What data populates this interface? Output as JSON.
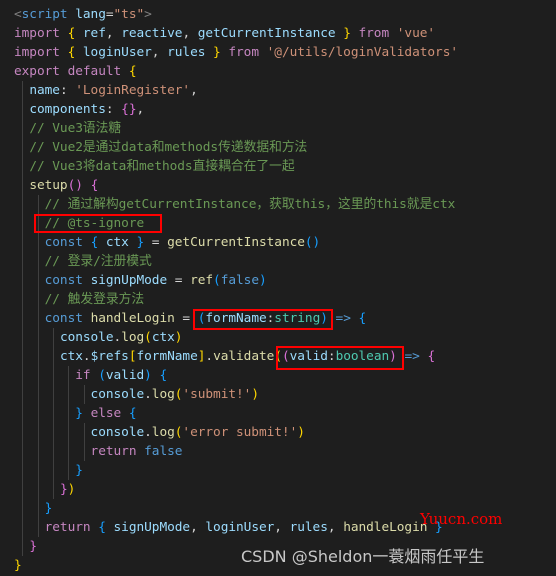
{
  "editor": {
    "language": "typescript",
    "lines": [
      [
        [
          "tag",
          "<"
        ],
        [
          "tagname",
          "script"
        ],
        [
          "p",
          " "
        ],
        [
          "var",
          "lang"
        ],
        [
          "p",
          "="
        ],
        [
          "str",
          "\"ts\""
        ],
        [
          "tag",
          ">"
        ]
      ],
      [
        [
          "kw",
          "import"
        ],
        [
          "p",
          " "
        ],
        [
          "b1",
          "{"
        ],
        [
          "p",
          " "
        ],
        [
          "var",
          "ref"
        ],
        [
          "p",
          ", "
        ],
        [
          "var",
          "reactive"
        ],
        [
          "p",
          ", "
        ],
        [
          "var",
          "getCurrentInstance"
        ],
        [
          "p",
          " "
        ],
        [
          "b1",
          "}"
        ],
        [
          "p",
          " "
        ],
        [
          "kw",
          "from"
        ],
        [
          "p",
          " "
        ],
        [
          "str",
          "'vue'"
        ]
      ],
      [
        [
          "kw",
          "import"
        ],
        [
          "p",
          " "
        ],
        [
          "b1",
          "{"
        ],
        [
          "p",
          " "
        ],
        [
          "var",
          "loginUser"
        ],
        [
          "p",
          ", "
        ],
        [
          "var",
          "rules"
        ],
        [
          "p",
          " "
        ],
        [
          "b1",
          "}"
        ],
        [
          "p",
          " "
        ],
        [
          "kw",
          "from"
        ],
        [
          "p",
          " "
        ],
        [
          "str",
          "'@/utils/loginValidators'"
        ]
      ],
      [
        [
          "kw",
          "export"
        ],
        [
          "p",
          " "
        ],
        [
          "kw",
          "default"
        ],
        [
          "p",
          " "
        ],
        [
          "b1",
          "{"
        ]
      ],
      [
        [
          "p",
          "  "
        ],
        [
          "var",
          "name"
        ],
        [
          "p",
          ": "
        ],
        [
          "str",
          "'LoginRegister'"
        ],
        [
          "p",
          ","
        ]
      ],
      [
        [
          "p",
          "  "
        ],
        [
          "var",
          "components"
        ],
        [
          "p",
          ": "
        ],
        [
          "b2",
          "{}"
        ],
        [
          "p",
          ","
        ]
      ],
      [
        [
          "p",
          "  "
        ],
        [
          "com",
          "// Vue3语法糖"
        ]
      ],
      [
        [
          "p",
          "  "
        ],
        [
          "com",
          "// Vue2是通过data和methods传递数据和方法"
        ]
      ],
      [
        [
          "p",
          "  "
        ],
        [
          "com",
          "// Vue3将data和methods直接耦合在了一起"
        ]
      ],
      [
        [
          "p",
          "  "
        ],
        [
          "fn",
          "setup"
        ],
        [
          "b2",
          "()"
        ],
        [
          "p",
          " "
        ],
        [
          "b2",
          "{"
        ]
      ],
      [
        [
          "p",
          "    "
        ],
        [
          "com",
          "// 通过解构getCurrentInstance，获取this，这里的this就是ctx"
        ]
      ],
      [
        [
          "p",
          "    "
        ],
        [
          "com",
          "// @ts-ignore"
        ]
      ],
      [
        [
          "p",
          "    "
        ],
        [
          "kw2",
          "const"
        ],
        [
          "p",
          " "
        ],
        [
          "b3",
          "{"
        ],
        [
          "p",
          " "
        ],
        [
          "var",
          "ctx"
        ],
        [
          "p",
          " "
        ],
        [
          "b3",
          "}"
        ],
        [
          "p",
          " = "
        ],
        [
          "fn",
          "getCurrentInstance"
        ],
        [
          "b3",
          "()"
        ]
      ],
      [
        [
          "p",
          "    "
        ],
        [
          "com",
          "// 登录/注册模式"
        ]
      ],
      [
        [
          "p",
          "    "
        ],
        [
          "kw2",
          "const"
        ],
        [
          "p",
          " "
        ],
        [
          "var",
          "signUpMode"
        ],
        [
          "p",
          " = "
        ],
        [
          "fn",
          "ref"
        ],
        [
          "b3",
          "("
        ],
        [
          "kw2",
          "false"
        ],
        [
          "b3",
          ")"
        ]
      ],
      [
        [
          "p",
          "    "
        ],
        [
          "com",
          "// 触发登录方法"
        ]
      ],
      [
        [
          "p",
          "    "
        ],
        [
          "kw2",
          "const"
        ],
        [
          "p",
          " "
        ],
        [
          "fn",
          "handleLogin"
        ],
        [
          "p",
          " = "
        ],
        [
          "b3",
          "("
        ],
        [
          "var",
          "formName"
        ],
        [
          "p",
          ":"
        ],
        [
          "type",
          "string"
        ],
        [
          "b3",
          ")"
        ],
        [
          "p",
          " "
        ],
        [
          "kw2",
          "=>"
        ],
        [
          "p",
          " "
        ],
        [
          "b3",
          "{"
        ]
      ],
      [
        [
          "p",
          "      "
        ],
        [
          "var",
          "console"
        ],
        [
          "p",
          "."
        ],
        [
          "fn",
          "log"
        ],
        [
          "b1",
          "("
        ],
        [
          "var",
          "ctx"
        ],
        [
          "b1",
          ")"
        ]
      ],
      [
        [
          "p",
          "      "
        ],
        [
          "var",
          "ctx"
        ],
        [
          "p",
          "."
        ],
        [
          "var",
          "$refs"
        ],
        [
          "b1",
          "["
        ],
        [
          "var",
          "formName"
        ],
        [
          "b1",
          "]"
        ],
        [
          "p",
          "."
        ],
        [
          "fn",
          "validate"
        ],
        [
          "b1",
          "("
        ],
        [
          "b2",
          "("
        ],
        [
          "var",
          "valid"
        ],
        [
          "p",
          ":"
        ],
        [
          "type",
          "boolean"
        ],
        [
          "b2",
          ")"
        ],
        [
          "p",
          " "
        ],
        [
          "kw2",
          "=>"
        ],
        [
          "p",
          " "
        ],
        [
          "b2",
          "{"
        ]
      ],
      [
        [
          "p",
          "        "
        ],
        [
          "kw",
          "if"
        ],
        [
          "p",
          " "
        ],
        [
          "b3",
          "("
        ],
        [
          "var",
          "valid"
        ],
        [
          "b3",
          ")"
        ],
        [
          "p",
          " "
        ],
        [
          "b3",
          "{"
        ]
      ],
      [
        [
          "p",
          "          "
        ],
        [
          "var",
          "console"
        ],
        [
          "p",
          "."
        ],
        [
          "fn",
          "log"
        ],
        [
          "b1",
          "("
        ],
        [
          "str",
          "'submit!'"
        ],
        [
          "b1",
          ")"
        ]
      ],
      [
        [
          "p",
          "        "
        ],
        [
          "b3",
          "}"
        ],
        [
          "p",
          " "
        ],
        [
          "kw",
          "else"
        ],
        [
          "p",
          " "
        ],
        [
          "b3",
          "{"
        ]
      ],
      [
        [
          "p",
          "          "
        ],
        [
          "var",
          "console"
        ],
        [
          "p",
          "."
        ],
        [
          "fn",
          "log"
        ],
        [
          "b1",
          "("
        ],
        [
          "str",
          "'error submit!'"
        ],
        [
          "b1",
          ")"
        ]
      ],
      [
        [
          "p",
          "          "
        ],
        [
          "kw",
          "return"
        ],
        [
          "p",
          " "
        ],
        [
          "kw2",
          "false"
        ]
      ],
      [
        [
          "p",
          "        "
        ],
        [
          "b3",
          "}"
        ]
      ],
      [
        [
          "p",
          "      "
        ],
        [
          "b2",
          "}"
        ],
        [
          "b1",
          ")"
        ]
      ],
      [
        [
          "p",
          "    "
        ],
        [
          "b3",
          "}"
        ]
      ],
      [
        [
          "p",
          "    "
        ],
        [
          "kw",
          "return"
        ],
        [
          "p",
          " "
        ],
        [
          "b3",
          "{"
        ],
        [
          "p",
          " "
        ],
        [
          "var",
          "signUpMode"
        ],
        [
          "p",
          ", "
        ],
        [
          "var",
          "loginUser"
        ],
        [
          "p",
          ", "
        ],
        [
          "var",
          "rules"
        ],
        [
          "p",
          ", "
        ],
        [
          "fn",
          "handleLogin"
        ],
        [
          "p",
          " "
        ],
        [
          "b3",
          "}"
        ]
      ],
      [
        [
          "p",
          "  "
        ],
        [
          "b2",
          "}"
        ]
      ],
      [
        [
          "b1",
          "}"
        ]
      ]
    ]
  },
  "annotations": {
    "highlight_ts_ignore": "// @ts-ignore",
    "highlight_formname_param": "(formName:string)",
    "highlight_valid_param": "(valid:boolean)"
  },
  "watermarks": {
    "site": "Yuucn.com",
    "author": "CSDN @Sheldon一蓑烟雨任平生"
  }
}
